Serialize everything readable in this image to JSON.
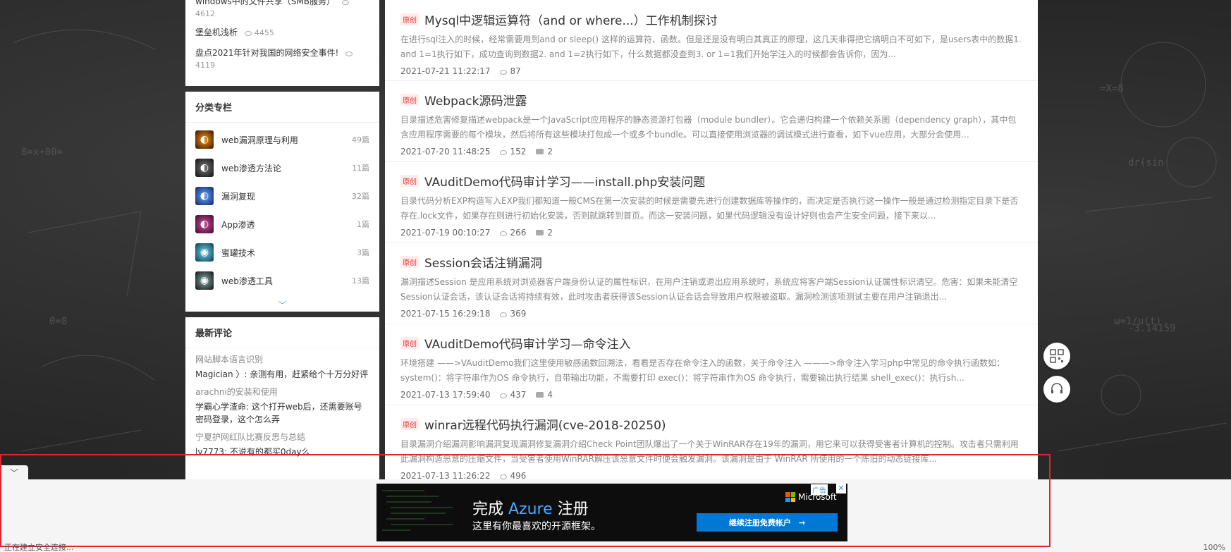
{
  "hot_articles": [
    {
      "title": "windows中的文件共享（SMB服务）",
      "views": "4612"
    },
    {
      "title": "堡垒机浅析",
      "views": "4455"
    },
    {
      "title": "盘点2021年针对我国的网络安全事件!",
      "views": "4119"
    }
  ],
  "categories": {
    "title": "分类专栏",
    "items": [
      {
        "name": "web漏洞原理与利用",
        "count": "49篇",
        "color": "#b3541e"
      },
      {
        "name": "web渗透方法论",
        "count": "11篇",
        "color": "#333333"
      },
      {
        "name": "漏洞复现",
        "count": "32篇",
        "color": "#1f4f9f"
      },
      {
        "name": "App渗透",
        "count": "1篇",
        "color": "#7a1c5a"
      },
      {
        "name": "蜜罐技术",
        "count": "3篇",
        "color": "#2a6a8a"
      },
      {
        "name": "web渗透工具",
        "count": "13篇",
        "color": "#1b1b1b"
      }
    ],
    "expand_icon": "chevron-down-icon"
  },
  "comments": {
    "title": "最新评论",
    "items": [
      {
        "title": "网站脚本语言识别",
        "body": "Magician 〉: 亲测有用，赶紧给个十万分好评"
      },
      {
        "title": "arachni的安装和使用",
        "body": "学霸心学渣命: 这个打开web后，还需要账号密码登录，这个怎么弄"
      },
      {
        "title": "宁夏护网红队比赛反思与总结",
        "body": "lv7773: 不说有的都买0day么"
      }
    ]
  },
  "articles": [
    {
      "tag": "原创",
      "title": "Mysql中逻辑运算符（and or where...）工作机制探讨",
      "desc": "在进行sql注入的时候，经常需要用到and or sleep() 这样的运算符、函数。但是还是没有明白其真正的原理，这几天非得把它搞明白不可如下，是users表中的数据1. and 1=1执行如下，成功查询到数据2. and 1=2执行如下，什么数据都没查到3. or 1=1我们开始学注入的时候都会告诉你，因为...",
      "date": "2021-07-21 11:22:17",
      "views": "87",
      "comments": ""
    },
    {
      "tag": "原创",
      "title": "Webpack源码泄露",
      "desc": "目录描述危害修复描述webpack是一个JavaScript应用程序的静态资源打包器（module bundler）。它会递归构建一个依赖关系图（dependency graph），其中包含应用程序需要的每个模块，然后将所有这些模块打包成一个或多个bundle。可以直接使用浏览器的调试模式进行查看，如下vue应用，大部分会使用...",
      "date": "2021-07-20 11:48:25",
      "views": "152",
      "comments": "2"
    },
    {
      "tag": "原创",
      "title": "VAuditDemo代码审计学习——install.php安装问题",
      "desc": "目录代码分析EXP构造写入EXP我们都知道一般CMS在第一次安装的时候是需要先进行创建数据库等操作的，而决定是否执行这一操作一般是通过检测指定目录下是否存在.lock文件，如果存在则进行初始化安装，否则就跳转到首页。而这一安装问题，如果代码逻辑没有设计好则也会产生安全问题，接下来以...",
      "date": "2021-07-19 00:10:27",
      "views": "266",
      "comments": "2"
    },
    {
      "tag": "原创",
      "title": "Session会话注销漏洞",
      "desc": "漏洞描述Session 是应用系统对浏览器客户端身份认证的属性标识，在用户注销或退出应用系统时，系统应将客户端Session认证属性标识清空。危害：如果未能清空Session认证会话，该认证会话将持续有效，此时攻击者获得该Session认证会话会导致用户权限被盗取。漏洞检测该项测试主要在用户注销退出...",
      "date": "2021-07-15 16:29:18",
      "views": "369",
      "comments": ""
    },
    {
      "tag": "原创",
      "title": "VAuditDemo代码审计学习—命令注入",
      "desc": "环境搭建 ——>VAuditDemo我们这里使用敏感函数回溯法，看看是否存在命令注入的函数，关于命令注入 ———>命令注入学习php中常见的命令执行函数如：system()：将字符串作为OS 命令执行，自带输出功能，不需要打印 exec()：将字符串作为OS 命令执行，需要输出执行结果 shell_exec()：执行sh...",
      "date": "2021-07-13 17:59:40",
      "views": "437",
      "comments": "4"
    },
    {
      "tag": "原创",
      "title": "winrar远程代码执行漏洞(cve-2018-20250)",
      "desc": "目录漏洞介绍漏洞影响漏洞复现漏洞修复漏洞介绍Check Point团队爆出了一个关于WinRAR存在19年的漏洞，用它来可以获得受害者计算机的控制。攻击者只需利用此漏洞构造恶意的压缩文件，当受害者使用WinRAR解压该恶意文件时便会触发漏洞。该漏洞是由于 WinRAR 所使用的一个陈旧的动态链接库...",
      "date": "2021-07-13 11:26:22",
      "views": "496",
      "comments": ""
    }
  ],
  "float_buttons": [
    {
      "icon": "qrcode-icon"
    },
    {
      "icon": "headset-icon"
    }
  ],
  "ad": {
    "headline_prefix": "完成 ",
    "headline_brand": "Azure",
    "headline_suffix": " 注册",
    "sub": "这里有你最喜欢的开源框架。",
    "logo": "Microsoft",
    "button": "继续注册免费帐户　→",
    "label": "广告",
    "close": "✕"
  },
  "status_bar": {
    "left": "正在建立安全连接...",
    "zoom": "100%",
    "zoom_label": "100%"
  },
  "colors": {
    "accent_red": "#e0262b",
    "ad_button": "#0078d4",
    "azure_text": "#4aa8ff"
  }
}
